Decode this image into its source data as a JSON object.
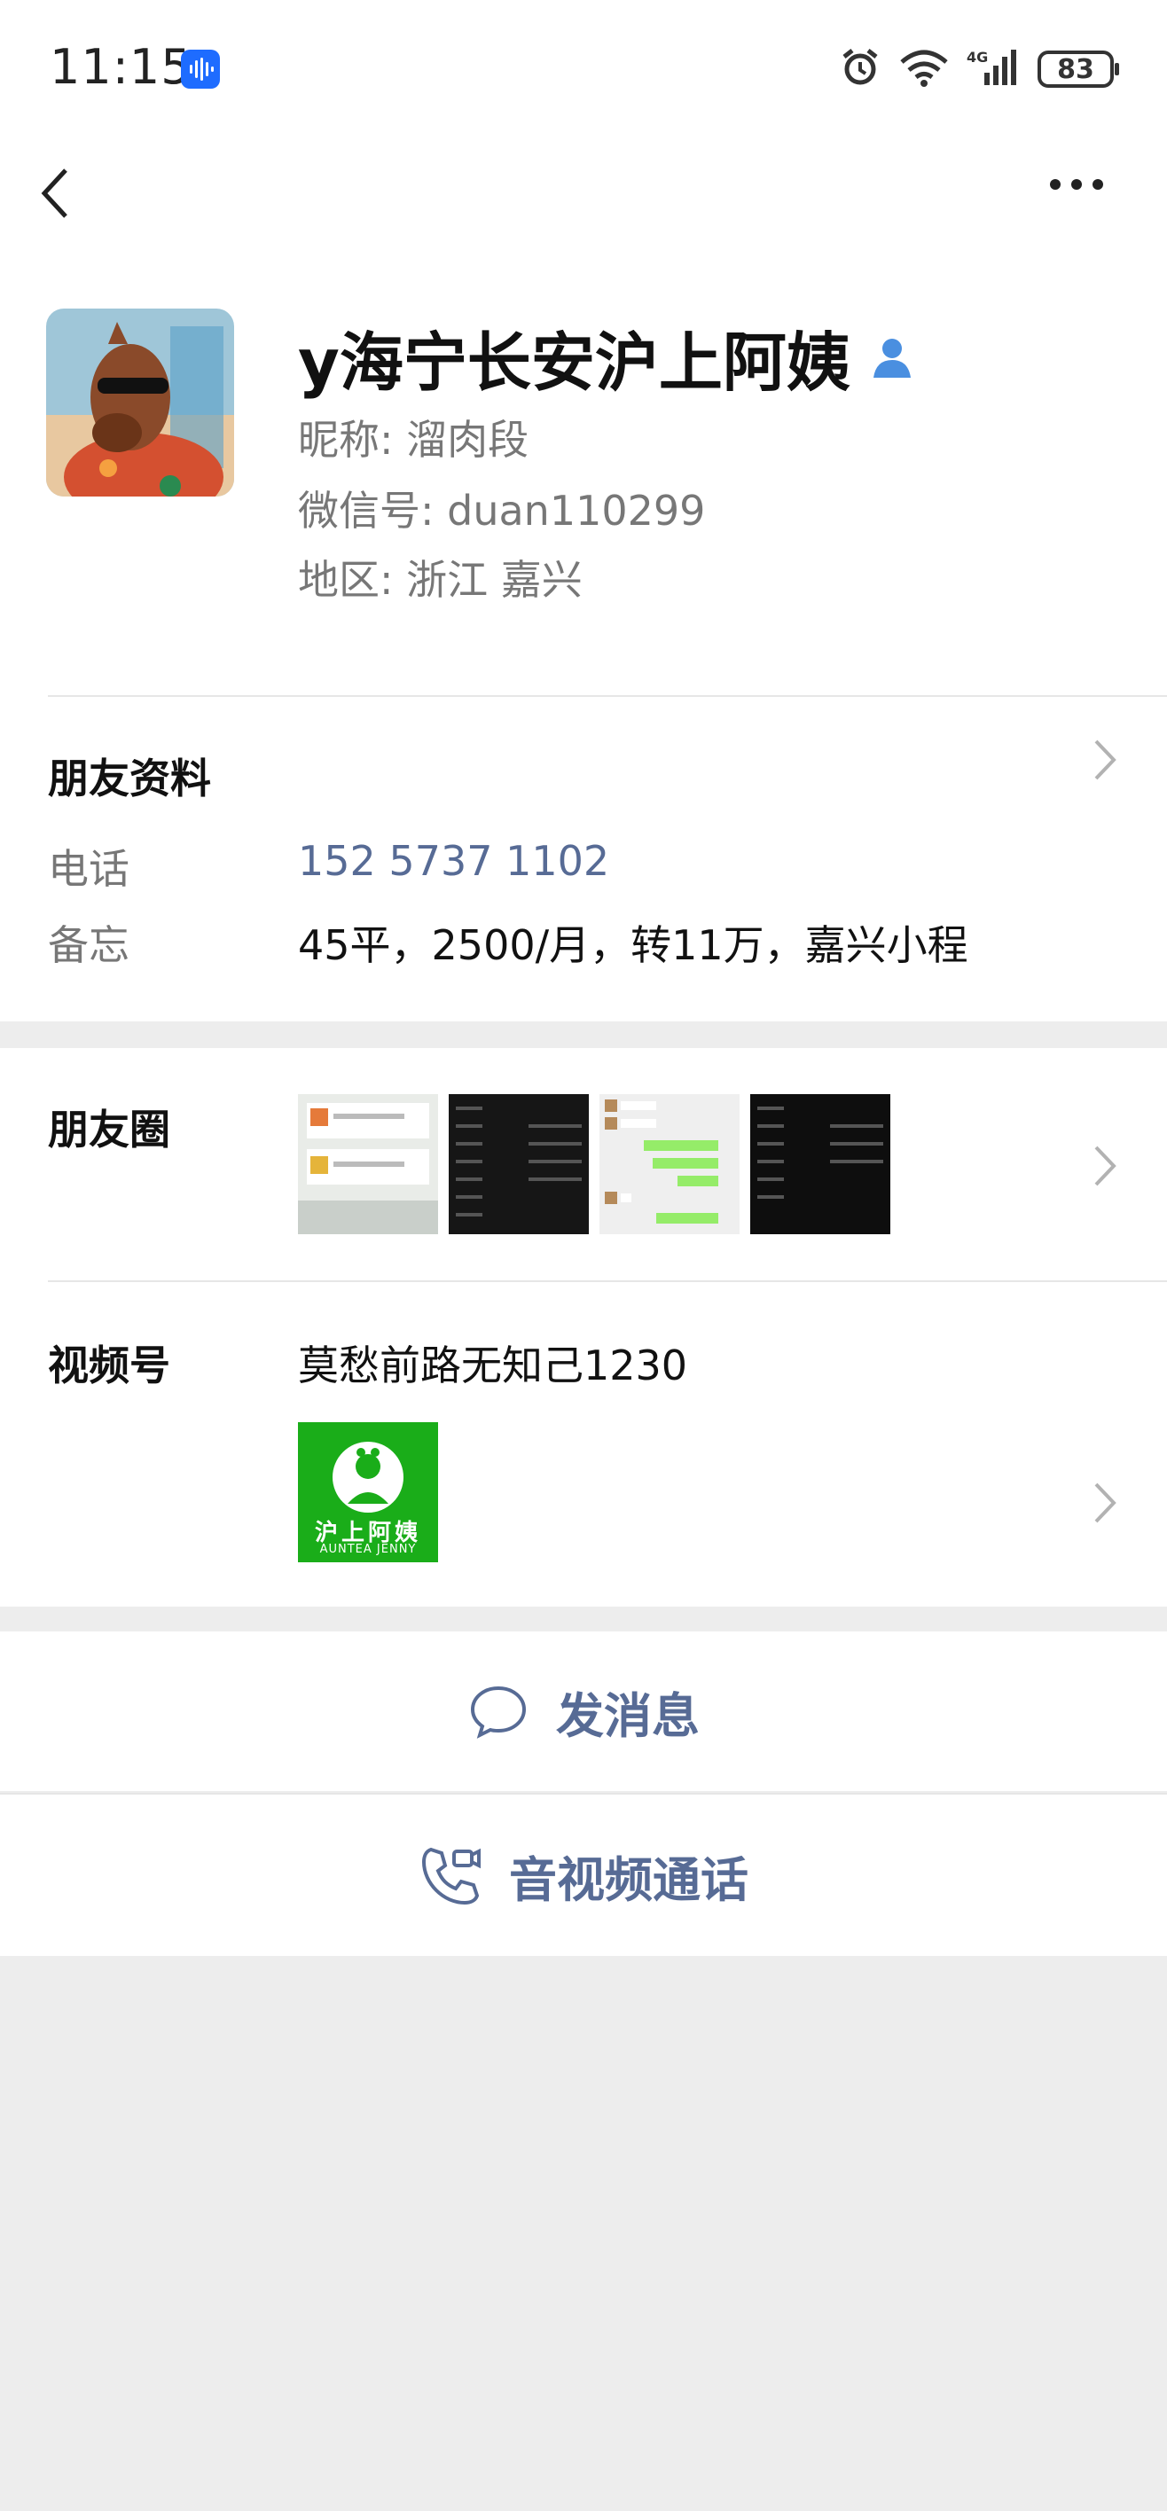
{
  "status_bar": {
    "time": "11:15",
    "battery": "83",
    "network": "4G"
  },
  "profile": {
    "display_name": "y海宁长安沪上阿姨",
    "nickname": "昵称:  溜肉段",
    "wechat_id": "微信号:  duan110299",
    "region": "地区:  浙江  嘉兴"
  },
  "friend_info": {
    "title": "朋友资料",
    "phone_label": "电话",
    "phone_value": "152 5737 1102",
    "remark_label": "备忘",
    "remark_value": "45平，2500/月，转11万，嘉兴小程"
  },
  "moments": {
    "title": "朋友圈"
  },
  "channels": {
    "title": "视频号",
    "name": "莫愁前路无知己1230",
    "logo_text": "沪上阿姨",
    "logo_subtext": "AUNTEA JENNY"
  },
  "actions": {
    "message": "发消息",
    "call": "音视频通话"
  },
  "colors": {
    "link": "#576b95",
    "accent_green": "#1aad19",
    "status_blue": "#1e6cff"
  }
}
